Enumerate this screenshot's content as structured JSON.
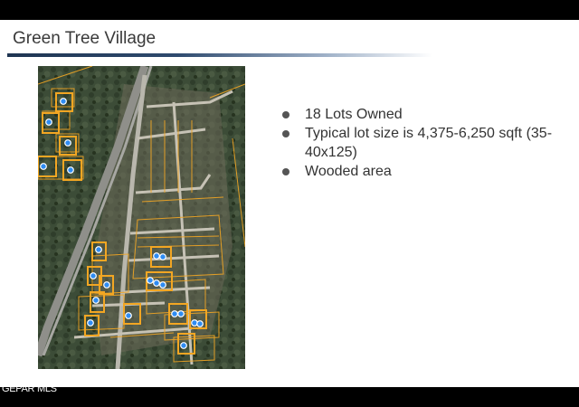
{
  "slide": {
    "title": "Green Tree Village",
    "bullets": [
      "18 Lots Owned",
      "Typical lot size is 4,375-6,250 sqft (35-40x125)",
      "Wooded area"
    ]
  },
  "map": {
    "image_kind": "aerial-parcel-map",
    "lot_outline_color": "#f2a623",
    "marker_color": "#2f8cf2",
    "owned_lot_count": 18
  },
  "footer": {
    "watermark": "GEPAR MLS"
  }
}
